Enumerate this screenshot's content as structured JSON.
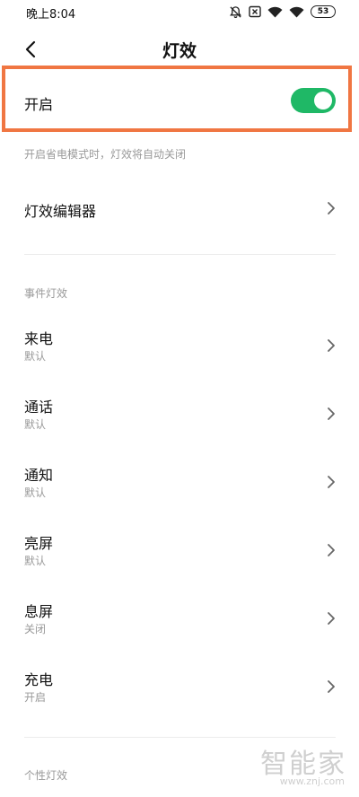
{
  "status_bar": {
    "time": "晚上8:04",
    "battery": "53",
    "icons": [
      "mute-bell-icon",
      "sim-off-icon",
      "wifi-icon",
      "wifi-icon",
      "battery-icon"
    ]
  },
  "header": {
    "title": "灯效",
    "back_icon": "chevron-left-icon"
  },
  "enable": {
    "label": "开启",
    "toggle_on": true,
    "toggle_color": "#1fb866",
    "highlight_color": "#f07642"
  },
  "hint": "开启省电模式时，灯效将自动关闭",
  "editor": {
    "label": "灯效编辑器"
  },
  "event_section": {
    "title": "事件灯效",
    "items": [
      {
        "title": "来电",
        "value": "默认"
      },
      {
        "title": "通话",
        "value": "默认"
      },
      {
        "title": "通知",
        "value": "默认"
      },
      {
        "title": "亮屏",
        "value": "默认"
      },
      {
        "title": "息屏",
        "value": "关闭"
      },
      {
        "title": "充电",
        "value": "开启"
      }
    ]
  },
  "custom_section": {
    "title": "个性灯效"
  },
  "watermark": {
    "text": "智能家",
    "url": "www.znj.com"
  }
}
